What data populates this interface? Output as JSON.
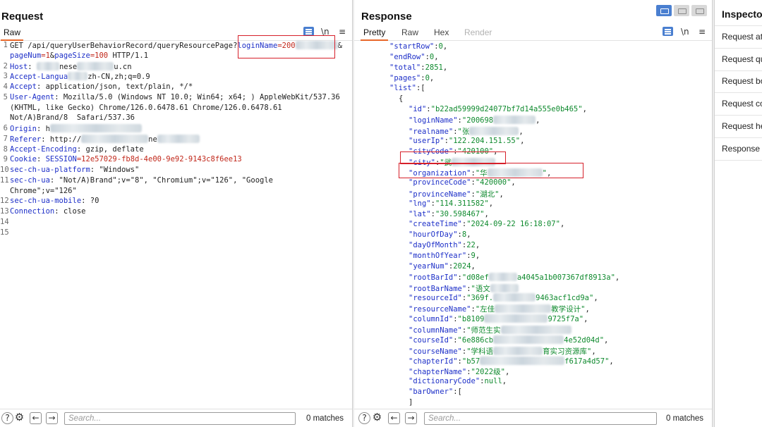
{
  "request": {
    "title": "Request",
    "tabs": [
      "Raw"
    ],
    "icons": {
      "wrap": "word-wrap-icon",
      "newline": "\\n",
      "menu": "≡"
    },
    "lines": [
      {
        "n": "1",
        "segs": [
          [
            "p",
            "GET /api/queryUserBehaviorRecord/queryResourcePage?"
          ],
          [
            "h",
            "loginName"
          ],
          [
            "r",
            "=200"
          ],
          [
            "b",
            ""
          ],
          [
            "p",
            "&"
          ]
        ]
      },
      {
        "n": "",
        "segs": [
          [
            "h",
            "pageNum"
          ],
          [
            "r",
            "=1"
          ],
          [
            "p",
            "&"
          ],
          [
            "h",
            "pageSize"
          ],
          [
            "r",
            "=100"
          ],
          [
            "p",
            " HTTP/1.1"
          ]
        ]
      },
      {
        "n": "2",
        "segs": [
          [
            "h",
            "Host"
          ],
          [
            "p",
            ": "
          ],
          [
            "b",
            ""
          ],
          [
            "p",
            "nese"
          ],
          [
            "b",
            ""
          ],
          [
            "p",
            "u.cn"
          ]
        ]
      },
      {
        "n": "3",
        "segs": [
          [
            "h",
            "Accept-Langua"
          ],
          [
            "b",
            ""
          ],
          [
            "p",
            "zh-CN,zh;q=0.9"
          ]
        ]
      },
      {
        "n": "4",
        "segs": [
          [
            "h",
            "Accept"
          ],
          [
            "p",
            ": application/json, text/plain, */*"
          ]
        ]
      },
      {
        "n": "5",
        "segs": [
          [
            "h",
            "User-Agent"
          ],
          [
            "p",
            ": Mozilla/5.0 (Windows NT 10.0; Win64; x64; ) AppleWebKit/537.36"
          ]
        ]
      },
      {
        "n": "",
        "segs": [
          [
            "p",
            "(KHTML, like Gecko) Chrome/126.0.6478.61 Chrome/126.0.6478.61"
          ]
        ]
      },
      {
        "n": "",
        "segs": [
          [
            "p",
            "Not/A)Brand/8  Safari/537.36"
          ]
        ]
      },
      {
        "n": "6",
        "segs": [
          [
            "h",
            "Origin"
          ],
          [
            "p",
            ": h"
          ],
          [
            "b",
            ""
          ]
        ]
      },
      {
        "n": "7",
        "segs": [
          [
            "h",
            "Referer"
          ],
          [
            "p",
            ": http://"
          ],
          [
            "b",
            ""
          ],
          [
            "p",
            "ne"
          ],
          [
            "b",
            ""
          ]
        ]
      },
      {
        "n": "8",
        "segs": [
          [
            "h",
            "Accept-Encoding"
          ],
          [
            "p",
            ": gzip, deflate"
          ]
        ]
      },
      {
        "n": "9",
        "segs": [
          [
            "h",
            "Cookie"
          ],
          [
            "p",
            ": "
          ],
          [
            "h",
            "SESSION"
          ],
          [
            "r",
            "=12e57029-fb8d-4e00-9e92-9143c8f6ee13"
          ]
        ]
      },
      {
        "n": "10",
        "segs": [
          [
            "h",
            "sec-ch-ua-platform"
          ],
          [
            "p",
            ": \"Windows\""
          ]
        ]
      },
      {
        "n": "11",
        "segs": [
          [
            "h",
            "sec-ch-ua"
          ],
          [
            "p",
            ": \"Not/A)Brand\";v=\"8\", \"Chromium\";v=\"126\", \"Google"
          ]
        ]
      },
      {
        "n": "",
        "segs": [
          [
            "p",
            "Chrome\";v=\"126\""
          ]
        ]
      },
      {
        "n": "12",
        "segs": [
          [
            "h",
            "sec-ch-ua-mobile"
          ],
          [
            "p",
            ": ?0"
          ]
        ]
      },
      {
        "n": "13",
        "segs": [
          [
            "h",
            "Connection"
          ],
          [
            "p",
            ": close"
          ]
        ]
      },
      {
        "n": "14",
        "segs": []
      },
      {
        "n": "15",
        "segs": []
      }
    ],
    "search_placeholder": "Search...",
    "matches": "0 matches"
  },
  "response": {
    "title": "Response",
    "tabs": [
      "Pretty",
      "Raw",
      "Hex",
      "Render"
    ],
    "icons": {
      "wrap": "word-wrap-icon",
      "newline": "\\n",
      "menu": "≡"
    },
    "lines": [
      {
        "i": 1,
        "segs": [
          [
            "k",
            "\"startRow\""
          ],
          [
            "p",
            ":"
          ],
          [
            "n",
            "0"
          ],
          [
            "p",
            ","
          ]
        ]
      },
      {
        "i": 1,
        "segs": [
          [
            "k",
            "\"endRow\""
          ],
          [
            "p",
            ":"
          ],
          [
            "n",
            "0"
          ],
          [
            "p",
            ","
          ]
        ]
      },
      {
        "i": 1,
        "segs": [
          [
            "k",
            "\"total\""
          ],
          [
            "p",
            ":"
          ],
          [
            "n",
            "2851"
          ],
          [
            "p",
            ","
          ]
        ]
      },
      {
        "i": 1,
        "segs": [
          [
            "k",
            "\"pages\""
          ],
          [
            "p",
            ":"
          ],
          [
            "n",
            "0"
          ],
          [
            "p",
            ","
          ]
        ]
      },
      {
        "i": 1,
        "segs": [
          [
            "k",
            "\"list\""
          ],
          [
            "p",
            ":["
          ]
        ]
      },
      {
        "i": 2,
        "segs": [
          [
            "p",
            "{"
          ]
        ]
      },
      {
        "i": 3,
        "segs": [
          [
            "k",
            "\"id\""
          ],
          [
            "p",
            ":"
          ],
          [
            "s",
            "\"b22ad59999d24077bf7d14a555e0b465\""
          ],
          [
            "p",
            ","
          ]
        ]
      },
      {
        "i": 3,
        "segs": [
          [
            "k",
            "\"loginName\""
          ],
          [
            "p",
            ":"
          ],
          [
            "s",
            "\"200698"
          ],
          [
            "b",
            ""
          ],
          [
            "p",
            ","
          ]
        ]
      },
      {
        "i": 3,
        "segs": [
          [
            "k",
            "\"realname\""
          ],
          [
            "p",
            ":"
          ],
          [
            "s",
            "\"张"
          ],
          [
            "b",
            ""
          ],
          [
            "p",
            ","
          ]
        ]
      },
      {
        "i": 3,
        "segs": [
          [
            "k",
            "\"userIp\""
          ],
          [
            "p",
            ":"
          ],
          [
            "s",
            "\"122.204.151.55\""
          ],
          [
            "p",
            ","
          ]
        ]
      },
      {
        "i": 3,
        "segs": [
          [
            "k",
            "\"cityCode\""
          ],
          [
            "p",
            ":"
          ],
          [
            "s",
            "\"420100\""
          ],
          [
            "p",
            ","
          ]
        ]
      },
      {
        "i": 3,
        "segs": [
          [
            "k",
            "\"city\""
          ],
          [
            "p",
            ":"
          ],
          [
            "s",
            "\"武"
          ],
          [
            "b",
            ""
          ]
        ]
      },
      {
        "i": 3,
        "segs": [
          [
            "k",
            "\"organization\""
          ],
          [
            "p",
            ":"
          ],
          [
            "s",
            "\"华"
          ],
          [
            "b",
            ""
          ],
          [
            "s",
            "\""
          ],
          [
            "p",
            ","
          ]
        ]
      },
      {
        "i": 3,
        "segs": [
          [
            "k",
            "\"provinceCode\""
          ],
          [
            "p",
            ":"
          ],
          [
            "s",
            "\"420000\""
          ],
          [
            "p",
            ","
          ]
        ]
      },
      {
        "i": 3,
        "segs": [
          [
            "k",
            "\"provinceName\""
          ],
          [
            "p",
            ":"
          ],
          [
            "s",
            "\"湖北\""
          ],
          [
            "p",
            ","
          ]
        ]
      },
      {
        "i": 3,
        "segs": [
          [
            "k",
            "\"lng\""
          ],
          [
            "p",
            ":"
          ],
          [
            "s",
            "\"114.311582\""
          ],
          [
            "p",
            ","
          ]
        ]
      },
      {
        "i": 3,
        "segs": [
          [
            "k",
            "\"lat\""
          ],
          [
            "p",
            ":"
          ],
          [
            "s",
            "\"30.598467\""
          ],
          [
            "p",
            ","
          ]
        ]
      },
      {
        "i": 3,
        "segs": [
          [
            "k",
            "\"createTime\""
          ],
          [
            "p",
            ":"
          ],
          [
            "s",
            "\"2024-09-22 16:18:07\""
          ],
          [
            "p",
            ","
          ]
        ]
      },
      {
        "i": 3,
        "segs": [
          [
            "k",
            "\"hourOfDay\""
          ],
          [
            "p",
            ":"
          ],
          [
            "n",
            "8"
          ],
          [
            "p",
            ","
          ]
        ]
      },
      {
        "i": 3,
        "segs": [
          [
            "k",
            "\"dayOfMonth\""
          ],
          [
            "p",
            ":"
          ],
          [
            "n",
            "22"
          ],
          [
            "p",
            ","
          ]
        ]
      },
      {
        "i": 3,
        "segs": [
          [
            "k",
            "\"monthOfYear\""
          ],
          [
            "p",
            ":"
          ],
          [
            "n",
            "9"
          ],
          [
            "p",
            ","
          ]
        ]
      },
      {
        "i": 3,
        "segs": [
          [
            "k",
            "\"yearNum\""
          ],
          [
            "p",
            ":"
          ],
          [
            "n",
            "2024"
          ],
          [
            "p",
            ","
          ]
        ]
      },
      {
        "i": 3,
        "segs": [
          [
            "k",
            "\"rootBarId\""
          ],
          [
            "p",
            ":"
          ],
          [
            "s",
            "\"d08ef"
          ],
          [
            "b",
            ""
          ],
          [
            "s",
            "a4045a1b007367df8913a\""
          ],
          [
            "p",
            ","
          ]
        ]
      },
      {
        "i": 3,
        "segs": [
          [
            "k",
            "\"rootBarName\""
          ],
          [
            "p",
            ":"
          ],
          [
            "s",
            "\"语文"
          ],
          [
            "b",
            ""
          ]
        ]
      },
      {
        "i": 3,
        "segs": [
          [
            "k",
            "\"resourceId\""
          ],
          [
            "p",
            ":"
          ],
          [
            "s",
            "\"369f."
          ],
          [
            "b",
            ""
          ],
          [
            "s",
            "9463acf1cd9a\""
          ],
          [
            "p",
            ","
          ]
        ]
      },
      {
        "i": 3,
        "segs": [
          [
            "k",
            "\"resourceName\""
          ],
          [
            "p",
            ":"
          ],
          [
            "s",
            "\"左佳"
          ],
          [
            "b",
            ""
          ],
          [
            "s",
            "教学设计\""
          ],
          [
            "p",
            ","
          ]
        ]
      },
      {
        "i": 3,
        "segs": [
          [
            "k",
            "\"columnId\""
          ],
          [
            "p",
            ":"
          ],
          [
            "s",
            "\"b8109"
          ],
          [
            "b",
            ""
          ],
          [
            "s",
            "9725f7a\""
          ],
          [
            "p",
            ","
          ]
        ]
      },
      {
        "i": 3,
        "segs": [
          [
            "k",
            "\"columnName\""
          ],
          [
            "p",
            ":"
          ],
          [
            "s",
            "\"师范生实"
          ],
          [
            "b",
            ""
          ]
        ]
      },
      {
        "i": 3,
        "segs": [
          [
            "k",
            "\"courseId\""
          ],
          [
            "p",
            ":"
          ],
          [
            "s",
            "\"6e886cb"
          ],
          [
            "b",
            ""
          ],
          [
            "s",
            "4e52d04d\""
          ],
          [
            "p",
            ","
          ]
        ]
      },
      {
        "i": 3,
        "segs": [
          [
            "k",
            "\"courseName\""
          ],
          [
            "p",
            ":"
          ],
          [
            "s",
            "\"学科语"
          ],
          [
            "b",
            ""
          ],
          [
            "s",
            "育实习资源库\""
          ],
          [
            "p",
            ","
          ]
        ]
      },
      {
        "i": 3,
        "segs": [
          [
            "k",
            "\"chapterId\""
          ],
          [
            "p",
            ":"
          ],
          [
            "s",
            "\"b57"
          ],
          [
            "b",
            ""
          ],
          [
            "s",
            "f617a4d57\""
          ],
          [
            "p",
            ","
          ]
        ]
      },
      {
        "i": 3,
        "segs": [
          [
            "k",
            "\"chapterName\""
          ],
          [
            "p",
            ":"
          ],
          [
            "s",
            "\"2022级\""
          ],
          [
            "p",
            ","
          ]
        ]
      },
      {
        "i": 3,
        "segs": [
          [
            "k",
            "\"dictionaryCode\""
          ],
          [
            "p",
            ":"
          ],
          [
            "n",
            "null"
          ],
          [
            "p",
            ","
          ]
        ]
      },
      {
        "i": 3,
        "segs": [
          [
            "k",
            "\"barOwner\""
          ],
          [
            "p",
            ":["
          ]
        ]
      },
      {
        "i": 3,
        "segs": [
          [
            "p",
            "]"
          ]
        ]
      }
    ],
    "search_placeholder": "Search...",
    "matches": "0 matches"
  },
  "inspector": {
    "title": "Inspecto",
    "items": [
      "Request at",
      "Request qu",
      "Request bo",
      "Request co",
      "Request he",
      "Response h"
    ]
  },
  "colors": {
    "highlight_box": "#d6202a",
    "tab_underline": "#e8672a",
    "accent": "#4a7fd0"
  }
}
